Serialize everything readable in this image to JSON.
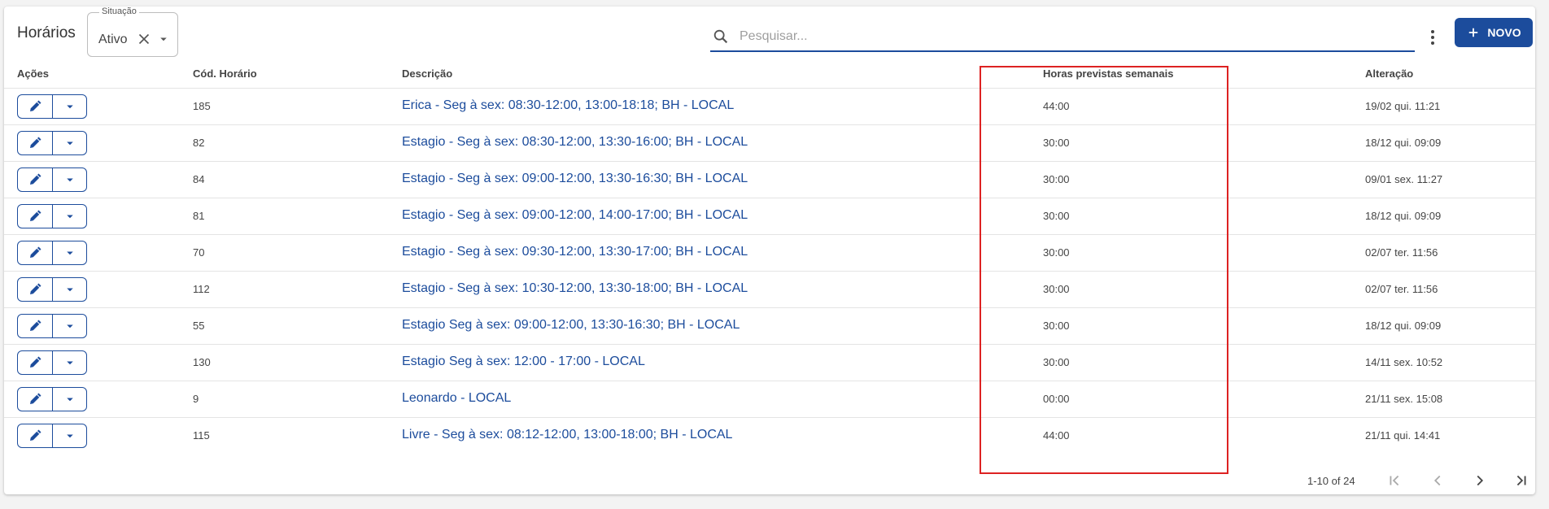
{
  "page": {
    "title": "Horários"
  },
  "filter": {
    "legend": "Situação",
    "value": "Ativo"
  },
  "search": {
    "placeholder": "Pesquisar..."
  },
  "toolbar": {
    "new_label": "NOVO",
    "accent": "#1c4c9c"
  },
  "table": {
    "columns": [
      "Ações",
      "Cód. Horário",
      "Descrição",
      "Horas previstas semanais",
      "Alteração"
    ],
    "rows": [
      {
        "code": "185",
        "description": "Erica - Seg à sex: 08:30-12:00, 13:00-18:18; BH - LOCAL",
        "hours": "44:00",
        "changed": "19/02 qui. 11:21"
      },
      {
        "code": "82",
        "description": "Estagio - Seg à sex: 08:30-12:00, 13:30-16:00; BH - LOCAL",
        "hours": "30:00",
        "changed": "18/12 qui. 09:09"
      },
      {
        "code": "84",
        "description": "Estagio - Seg à sex: 09:00-12:00, 13:30-16:30; BH - LOCAL",
        "hours": "30:00",
        "changed": "09/01 sex. 11:27"
      },
      {
        "code": "81",
        "description": "Estagio - Seg à sex: 09:00-12:00, 14:00-17:00; BH - LOCAL",
        "hours": "30:00",
        "changed": "18/12 qui. 09:09"
      },
      {
        "code": "70",
        "description": "Estagio - Seg à sex: 09:30-12:00, 13:30-17:00; BH - LOCAL",
        "hours": "30:00",
        "changed": "02/07 ter. 11:56"
      },
      {
        "code": "112",
        "description": "Estagio - Seg à sex: 10:30-12:00, 13:30-18:00; BH - LOCAL",
        "hours": "30:00",
        "changed": "02/07 ter. 11:56"
      },
      {
        "code": "55",
        "description": "Estagio Seg à sex: 09:00-12:00, 13:30-16:30; BH - LOCAL",
        "hours": "30:00",
        "changed": "18/12 qui. 09:09"
      },
      {
        "code": "130",
        "description": "Estagio Seg à sex: 12:00 - 17:00 - LOCAL",
        "hours": "30:00",
        "changed": "14/11 sex. 10:52"
      },
      {
        "code": "9",
        "description": "Leonardo - LOCAL",
        "hours": "00:00",
        "changed": "21/11 sex. 15:08"
      },
      {
        "code": "115",
        "description": "Livre - Seg à sex: 08:12-12:00, 13:00-18:00; BH - LOCAL",
        "hours": "44:00",
        "changed": "21/11 qui. 14:41"
      }
    ]
  },
  "pagination": {
    "range": "1-10 of 24"
  },
  "highlight": {
    "color": "#dd2222"
  }
}
